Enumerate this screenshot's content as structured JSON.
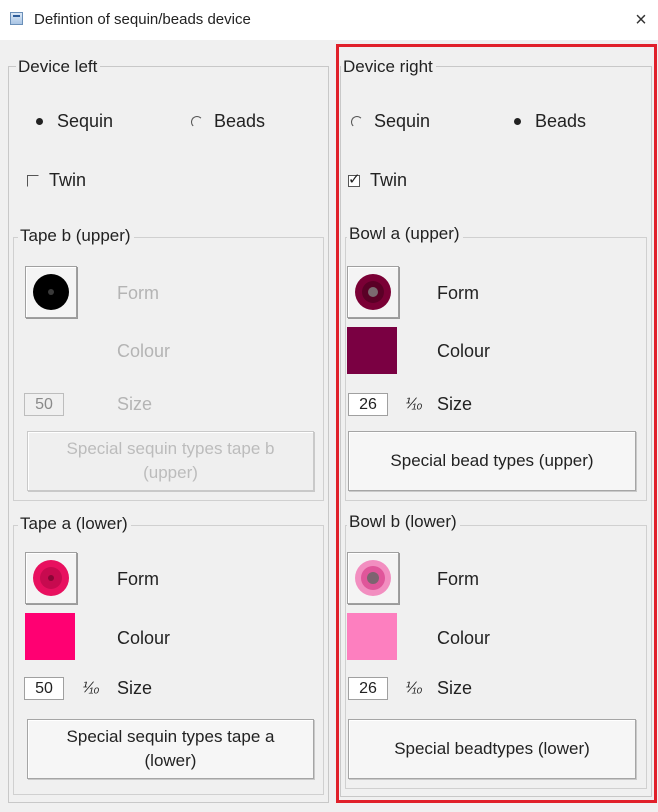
{
  "window": {
    "title": "Defintion of sequin/beads device",
    "close_glyph": "×"
  },
  "left": {
    "group_title": "Device left",
    "radio_sequin": "Sequin",
    "radio_beads": "Beads",
    "selected": "Sequin",
    "twin_label": "Twin",
    "twin_checked": false,
    "upper": {
      "title": "Tape b (upper)",
      "form_label": "Form",
      "colour_label": "Colour",
      "size_value": "50",
      "size_label": "Size",
      "button_label": "Special sequin types tape b (upper)",
      "enabled": false,
      "form_color": "#000000"
    },
    "lower": {
      "title": "Tape a (lower)",
      "form_label": "Form",
      "colour_label": "Colour",
      "size_value": "50",
      "unit": "⅟₁₀",
      "size_label": "Size",
      "button_label": "Special sequin types tape a (lower)",
      "enabled": true,
      "form_color": "#e8105f",
      "colour": "#ff0072"
    }
  },
  "right": {
    "group_title": "Device right",
    "radio_sequin": "Sequin",
    "radio_beads": "Beads",
    "selected": "Beads",
    "twin_label": "Twin",
    "twin_checked": true,
    "upper": {
      "title": "Bowl a (upper)",
      "form_label": "Form",
      "colour_label": "Colour",
      "size_value": "26",
      "unit": "⅟₁₀",
      "size_label": "Size",
      "button_label": "Special bead types (upper)",
      "form_color": "#7a0035",
      "colour": "#7a0042"
    },
    "lower": {
      "title": "Bowl b (lower)",
      "form_label": "Form",
      "colour_label": "Colour",
      "size_value": "26",
      "unit": "⅟₁₀",
      "size_label": "Size",
      "button_label": "Special beadtypes (lower)",
      "form_color": "#f06aaa",
      "colour": "#fd7fbf"
    }
  },
  "highlight_color": "#e0202a"
}
